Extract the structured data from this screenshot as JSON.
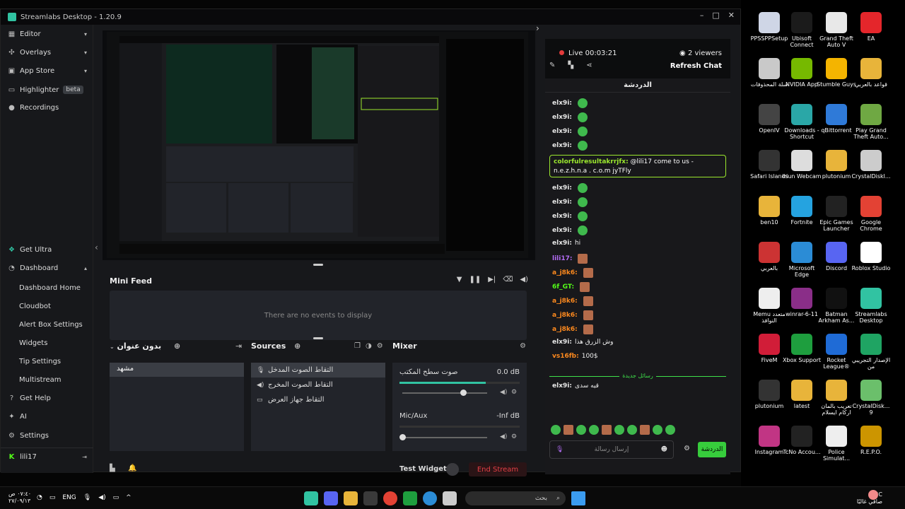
{
  "window": {
    "title": "Streamlabs Desktop - 1.20.9"
  },
  "sidebar": {
    "items": [
      {
        "label": "Editor",
        "icon": "editor-icon"
      },
      {
        "label": "Overlays",
        "icon": "overlays-icon"
      },
      {
        "label": "App Store",
        "icon": "app-store-icon"
      },
      {
        "label": "Highlighter",
        "badge": "beta",
        "icon": "highlighter-icon"
      },
      {
        "label": "Recordings",
        "icon": "recordings-icon"
      }
    ],
    "bottom": {
      "get_ultra": "Get Ultra",
      "dashboard": "Dashboard",
      "dashboard_sub": [
        "Dashboard Home",
        "Cloudbot",
        "Alert Box Settings",
        "Widgets",
        "Tip Settings",
        "Multistream"
      ],
      "get_help": "Get Help",
      "ai": "AI",
      "settings": "Settings",
      "user": "lili17"
    }
  },
  "mini_feed": {
    "title": "Mini Feed",
    "empty": "There are no events to display"
  },
  "scenes": {
    "title": "بدون عنوان",
    "items": [
      "مشهد"
    ]
  },
  "sources": {
    "title": "Sources",
    "items": [
      "التقاط الصوت المدخل",
      "التقاط الصوت المخرج",
      "التقاط جهاز العرض"
    ]
  },
  "mixer": {
    "title": "Mixer",
    "channels": [
      {
        "name": "صوت سطح المكتب",
        "db": "0.0 dB",
        "level": 0.72
      },
      {
        "name": "Mic/Aux",
        "db": "-Inf dB",
        "level": 0.0
      }
    ]
  },
  "footer": {
    "test_widgets": "Test Widgets",
    "end_stream": "End Stream"
  },
  "chat": {
    "live": "Live 00:03:21",
    "viewers": "2 viewers",
    "refresh": "Refresh Chat",
    "title": "الدردشة",
    "messages": [
      {
        "user": "elx9i:",
        "text": ""
      },
      {
        "user": "elx9i:",
        "text": ""
      },
      {
        "user": "elx9i:",
        "text": ""
      },
      {
        "user": "elx9i:",
        "text": ""
      },
      {
        "user": "elx9i:",
        "text": ""
      },
      {
        "user": "elx9i:",
        "text": ""
      },
      {
        "user": "elx9i:",
        "text": ""
      },
      {
        "user": "elx9i:",
        "text": ""
      },
      {
        "user": "elx9i:",
        "text": "hi"
      },
      {
        "user": "lili17:",
        "text": ""
      },
      {
        "user": "a_j8k6:",
        "text": ""
      },
      {
        "user": "6f_GT:",
        "text": ""
      },
      {
        "user": "a_j8k6:",
        "text": ""
      },
      {
        "user": "a_j8k6:",
        "text": ""
      },
      {
        "user": "a_j8k6:",
        "text": ""
      },
      {
        "user": "elx9i:",
        "text": "وش الزرق هذا"
      },
      {
        "user": "vs16fb:",
        "text": "100$"
      },
      {
        "user": "elx9i:",
        "text": "قيه سدى"
      }
    ],
    "highlight": {
      "user": "colorfulresultakrrjfx:",
      "text": "@lili17 come to us - n.e.z.h.n.a . c.o.m jyTFly"
    },
    "new_messages": "رسائل جديدة",
    "input_placeholder": "إرسال رسالة",
    "send": "الدردشة"
  },
  "desktop_icons": [
    {
      "label": "PPSSPPSetup"
    },
    {
      "label": "Ubisoft Connect"
    },
    {
      "label": "Grand Theft Auto V"
    },
    {
      "label": "EA"
    },
    {
      "label": "سلة المحذوفات"
    },
    {
      "label": "NVIDIA App"
    },
    {
      "label": "Stumble Guys"
    },
    {
      "label": "قواعد بالعربي"
    },
    {
      "label": "OpenIV"
    },
    {
      "label": "Downloads - Shortcut"
    },
    {
      "label": "qBittorrent"
    },
    {
      "label": "Play Grand Theft Auto..."
    },
    {
      "label": "Safari Islands"
    },
    {
      "label": "Iriun Webcam"
    },
    {
      "label": "plutonium"
    },
    {
      "label": "CrystalDiskl..."
    },
    {
      "label": "ben10"
    },
    {
      "label": "Fortnite"
    },
    {
      "label": "Epic Games Launcher"
    },
    {
      "label": "Google Chrome"
    },
    {
      "label": "بالعربي"
    },
    {
      "label": "Microsoft Edge"
    },
    {
      "label": "Discord"
    },
    {
      "label": "Roblox Studio"
    },
    {
      "label": "Memu متعدد النوافذ"
    },
    {
      "label": "winrar-6-11"
    },
    {
      "label": "Batman Arkham As..."
    },
    {
      "label": "Streamlabs Desktop"
    },
    {
      "label": "FiveM"
    },
    {
      "label": "Xbox Support"
    },
    {
      "label": "Rocket League®"
    },
    {
      "label": "الإصدار التجريبي من"
    },
    {
      "label": "plutonium"
    },
    {
      "label": "latest"
    },
    {
      "label": "تعريب بالمان اركام ايسلام"
    },
    {
      "label": "CrystalDisk... 9"
    },
    {
      "label": "Instagram"
    },
    {
      "label": "TcNo Accou..."
    },
    {
      "label": "Police Simulat..."
    },
    {
      "label": "R.E.P.O."
    }
  ],
  "taskbar": {
    "time": "٠٧:٤٠ ص",
    "date": "٢٧/٠٩/١٣",
    "lang": "ENG",
    "search": "بحث",
    "weather_temp": "8°C",
    "weather_desc": "صافي غالبًا"
  }
}
